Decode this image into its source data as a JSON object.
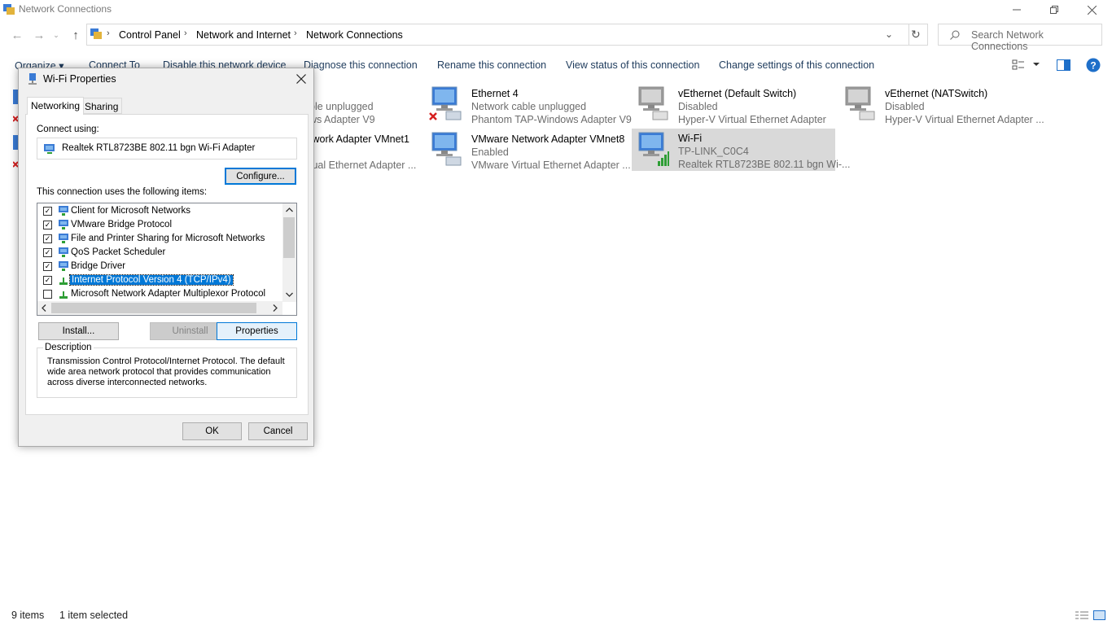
{
  "window": {
    "title": "Network Connections"
  },
  "address": {
    "crumbs": [
      "Control Panel",
      "Network and Internet",
      "Network Connections"
    ],
    "search_placeholder": "Search Network Connections"
  },
  "commands": {
    "organize": "Organize ▾",
    "connect_to": "Connect To",
    "disable": "Disable this network device",
    "diagnose": "Diagnose this connection",
    "rename": "Rename this connection",
    "view_status": "View status of this connection",
    "change_settings": "Change settings of this connection"
  },
  "connections": [
    {
      "name": "",
      "status": "ble unplugged",
      "adapter": "ws Adapter V9"
    },
    {
      "name": "Ethernet 4",
      "status": "Network cable unplugged",
      "adapter": "Phantom TAP-Windows Adapter V9"
    },
    {
      "name": "vEthernet (Default Switch)",
      "status": "Disabled",
      "adapter": "Hyper-V Virtual Ethernet Adapter"
    },
    {
      "name": "vEthernet (NATSwitch)",
      "status": "Disabled",
      "adapter": "Hyper-V Virtual Ethernet Adapter ..."
    },
    {
      "name": "twork Adapter VMnet1",
      "status": "",
      "adapter": "tual Ethernet Adapter ..."
    },
    {
      "name": "VMware Network Adapter VMnet8",
      "status": "Enabled",
      "adapter": "VMware Virtual Ethernet Adapter ..."
    },
    {
      "name": "Wi-Fi",
      "status": "TP-LINK_C0C4",
      "adapter": "Realtek RTL8723BE 802.11 bgn Wi-..."
    }
  ],
  "status_bar": {
    "items": "9 items",
    "selected": "1 item selected"
  },
  "dialog": {
    "title": "Wi-Fi Properties",
    "tabs": [
      "Networking",
      "Sharing"
    ],
    "connect_using_label": "Connect using:",
    "adapter": "Realtek RTL8723BE 802.11 bgn Wi-Fi Adapter",
    "configure": "Configure...",
    "items_label": "This connection uses the following items:",
    "items": [
      {
        "label": "Client for Microsoft Networks",
        "checked": true
      },
      {
        "label": "VMware Bridge Protocol",
        "checked": true
      },
      {
        "label": "File and Printer Sharing for Microsoft Networks",
        "checked": true
      },
      {
        "label": "QoS Packet Scheduler",
        "checked": true
      },
      {
        "label": "Bridge Driver",
        "checked": true
      },
      {
        "label": "Internet Protocol Version 4 (TCP/IPv4)",
        "checked": true
      },
      {
        "label": "Microsoft Network Adapter Multiplexor Protocol",
        "checked": false
      }
    ],
    "install": "Install...",
    "uninstall": "Uninstall",
    "properties": "Properties",
    "description_label": "Description",
    "description": "Transmission Control Protocol/Internet Protocol. The default wide area network protocol that provides communication across diverse interconnected networks.",
    "ok": "OK",
    "cancel": "Cancel"
  }
}
